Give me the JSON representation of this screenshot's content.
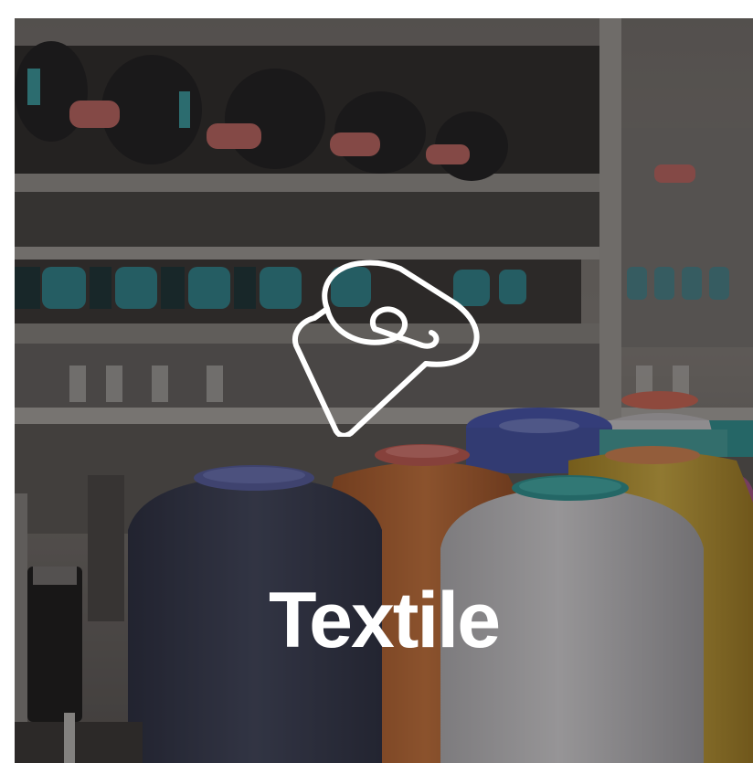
{
  "card": {
    "title": "Textile",
    "icon": "fabric-roll-icon",
    "spool_colors": {
      "navy": "#3d4258",
      "orange": "#c46a36",
      "white": "#d8d6d8",
      "yellow": "#c9a63a",
      "blue": "#3f4fa3",
      "teal": "#4aa3a3",
      "magenta": "#a0487c"
    }
  }
}
